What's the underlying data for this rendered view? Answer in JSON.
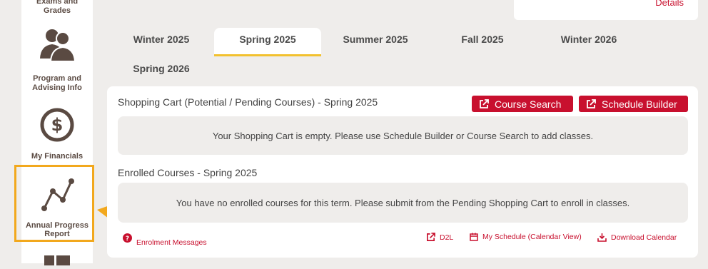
{
  "sidebar": {
    "items": [
      {
        "label_line1": "Exams and",
        "label_line2": "Grades",
        "icon": "exams-icon"
      },
      {
        "label_line1": "Program and",
        "label_line2": "Advising Info",
        "icon": "users-icon"
      },
      {
        "label_line1": "My Financials",
        "label_line2": "",
        "icon": "dollar-icon"
      },
      {
        "label_line1": "Annual Progress",
        "label_line2": "Report",
        "icon": "trend-line-icon"
      }
    ]
  },
  "header": {
    "details_link": "Details"
  },
  "tabs": [
    {
      "label": "Winter 2025",
      "active": false
    },
    {
      "label": "Spring 2025",
      "active": true
    },
    {
      "label": "Summer 2025",
      "active": false
    },
    {
      "label": "Fall 2025",
      "active": false
    },
    {
      "label": "Winter 2026",
      "active": false
    },
    {
      "label": "Spring 2026",
      "active": false
    }
  ],
  "shopping_cart": {
    "title": "Shopping Cart (Potential / Pending Courses) - Spring 2025",
    "course_search_label": "Course Search",
    "schedule_builder_label": "Schedule Builder",
    "empty_message": "Your Shopping Cart is empty. Please use Schedule Builder or Course Search to add classes."
  },
  "enrolled": {
    "title": "Enrolled Courses - Spring 2025",
    "empty_message": "You have no enrolled courses for this term. Please submit from the Pending Shopping Cart to enroll in classes."
  },
  "footer": {
    "enrolment_messages": "Enrolment Messages",
    "d2l": "D2L",
    "my_schedule": "My Schedule (Calendar View)",
    "download_calendar": "Download Calendar"
  },
  "colors": {
    "accent_red": "#c8102e",
    "highlight_orange": "#f2a81d",
    "tab_underline": "#f2c12e"
  }
}
